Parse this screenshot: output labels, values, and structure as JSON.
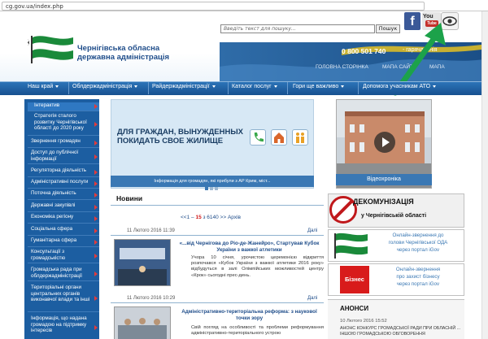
{
  "browser": {
    "url": "cg.gov.ua/index.php"
  },
  "header": {
    "logo_line1": "Чернігівська обласна",
    "logo_line2": "державна адміністрація",
    "search_placeholder": "Введіть текст для пошуку...",
    "search_button": "Пошук",
    "social": {
      "facebook": "f",
      "youtube_top": "You",
      "youtube_bottom": "Tube"
    },
    "phone": "0 800 501 740",
    "hotline": "- гаряча лінія",
    "top_links": [
      "ГОЛОВНА СТОРІНКА",
      "МАПА САЙТУ",
      "МАПА"
    ],
    "colors": {
      "brand_blue": "#1c5ea1",
      "nav_blue": "#2c74b8",
      "flag_green": "#1a8a3a",
      "accent_red": "#d01818",
      "arrow_green": "#1ca24a"
    }
  },
  "nav": {
    "items": [
      "Наш край",
      "Облдержадміністрація",
      "Райдержадміністрації",
      "Каталог послуг",
      "Гори ще важливо",
      "Допомога учасникам АТО"
    ]
  },
  "sidebar": {
    "items": [
      "Інтерактив",
      "Стратегія сталого розвитку Чернігівської області до 2020 року",
      "Звернення громадян",
      "Доступ до публічної інформації",
      "Регуляторна діяльність",
      "Адміністративні послуги",
      "Поточна діяльність",
      "Державні закупівлі",
      "Економіка регіону",
      "Соціальна сфера",
      "Гуманітарна сфера",
      "Консультації з громадськістю",
      "Громадська рада при облдержадміністрації",
      "Територіальні органи центральних органів виконавчої влади та інші",
      "Інформація, що надана громадою на підтримку інтересів"
    ]
  },
  "banner": {
    "headline_line1": "ДЛЯ ГРАЖДАН, ВЫНУЖДЕННЫХ",
    "headline_line2": "ПОКИДАТЬ СВОЕ ЖИЛИЩЕ",
    "strip": "Інформація для громадян, які прибули з АР Крим, міст..."
  },
  "video": {
    "label": "Відеохроніка"
  },
  "news": {
    "title": "Новини",
    "pager": {
      "prefix": "<<1 –",
      "current": "15",
      "suffix": "з 6140 >>",
      "archive": "Архів"
    },
    "articles": [
      {
        "date": "11 Лютого 2016 11:39",
        "more": "Далі",
        "title": "«...від Чернігова до Ріо-де-Жанейро», Стартував Кубок України з важкої атлетики",
        "body": "Учора 10 січня, урочистою церемонією відкриття розпочався «Кубок України з важкої атлетики 2016 року» відбудуться в залі Олімпійських можливостей центру «Крок» сьогодні прес-день."
      },
      {
        "date": "11 Лютого 2016 10:29",
        "more": "Далі",
        "title": "Адміністративно-територіальна реформа: з наукової точки зору",
        "body": "Свій погляд на особливості та проблеми реформування адміністративно-територіального устрою"
      }
    ]
  },
  "right": {
    "decom_title": "ДЕКОМУНІЗАЦІЯ",
    "decom_sub": "у Чернігівській області",
    "appeal_line1": "Онлайн-звернення до",
    "appeal_line2": "голови Чернігівської ОДА",
    "appeal_line3": "через портал iGov",
    "biz_logo": "Бізнес",
    "biz_line1": "Онлайн-звернення",
    "biz_line2": "про захист бізнесу",
    "biz_line3": "через портал iGov",
    "anonsy_title": "АНОНСИ",
    "anonsy_date": "10 Лютого 2016 15:52",
    "anonsy_body": "АНОНС КОНКУРС ГРОМАДСЬКОЇ РАДИ ПРИ ОБЛАСНІЙ ... ІНШОЮ ГРОМАДСЬКОЮ ОБГОВОРЕННЯ"
  }
}
